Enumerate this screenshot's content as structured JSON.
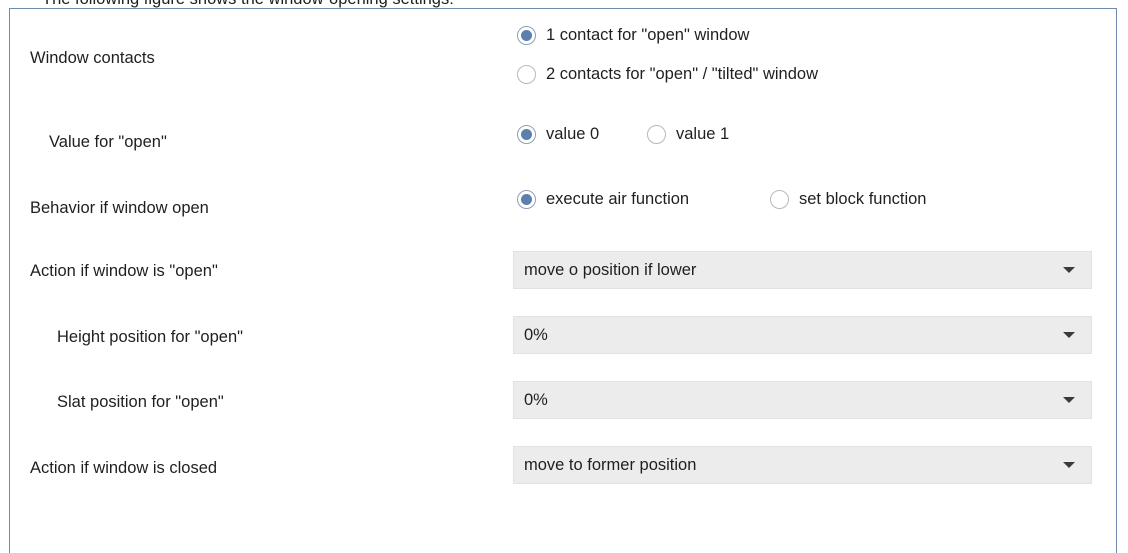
{
  "caption_cut": "The following figure shows the window-opening settings:",
  "rows": {
    "window_contacts": {
      "label": "Window contacts",
      "options": [
        "1 contact for \"open\" window",
        "2 contacts for \"open\" / \"tilted\" window"
      ],
      "selected": "1 contact for \"open\" window"
    },
    "value_for_open": {
      "label": "Value for \"open\"",
      "options": [
        "value 0",
        "value 1"
      ],
      "selected": "value 0"
    },
    "behavior": {
      "label": "Behavior if window open",
      "options": [
        "execute air function",
        "set block function"
      ],
      "selected": "execute air function"
    },
    "action_open": {
      "label": "Action if window is \"open\"",
      "value": "move o position if lower"
    },
    "height_open": {
      "label": "Height position for \"open\"",
      "value": "0%"
    },
    "slat_open": {
      "label": "Slat position for \"open\"",
      "value": "0%"
    },
    "action_closed": {
      "label": "Action if window is closed",
      "value": "move to former position"
    }
  },
  "icons": {
    "dropdown": "chevron-down-icon"
  },
  "colors": {
    "radio_selected": "#5c7fae",
    "panel_border": "#6f8aaa",
    "select_bg": "#ececec"
  }
}
